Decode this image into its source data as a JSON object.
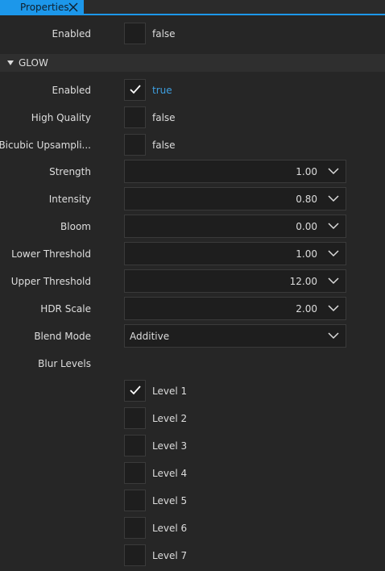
{
  "tab": {
    "label": "Properties"
  },
  "top_enabled": {
    "label": "Enabled",
    "value": "false"
  },
  "section": {
    "title": "GLOW"
  },
  "glow": {
    "enabled": {
      "label": "Enabled",
      "value": "true"
    },
    "high_quality": {
      "label": "High Quality",
      "value": "false"
    },
    "bicubic": {
      "label": "Bicubic Upsampli...",
      "value": "false"
    },
    "strength": {
      "label": "Strength",
      "value": "1.00"
    },
    "intensity": {
      "label": "Intensity",
      "value": "0.80"
    },
    "bloom": {
      "label": "Bloom",
      "value": "0.00"
    },
    "lower_threshold": {
      "label": "Lower Threshold",
      "value": "1.00"
    },
    "upper_threshold": {
      "label": "Upper Threshold",
      "value": "12.00"
    },
    "hdr_scale": {
      "label": "HDR Scale",
      "value": "2.00"
    },
    "blend_mode": {
      "label": "Blend Mode",
      "value": "Additive"
    },
    "blur_levels": {
      "label": "Blur Levels",
      "levels": [
        {
          "label": "Level 1",
          "checked": true
        },
        {
          "label": "Level 2",
          "checked": false
        },
        {
          "label": "Level 3",
          "checked": false
        },
        {
          "label": "Level 4",
          "checked": false
        },
        {
          "label": "Level 5",
          "checked": false
        },
        {
          "label": "Level 6",
          "checked": false
        },
        {
          "label": "Level 7",
          "checked": false
        }
      ]
    }
  },
  "colors": {
    "accent": "#1c97ea",
    "true_text": "#3e9fe0",
    "background": "#262626",
    "field": "#1e1e1e"
  }
}
